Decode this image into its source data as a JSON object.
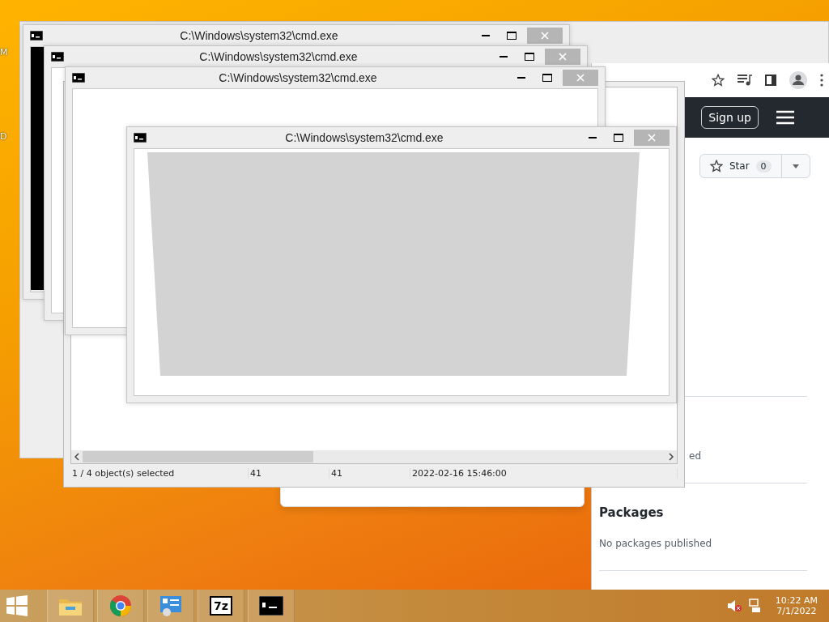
{
  "desktop": {
    "icon_labels": [
      "M",
      "D"
    ]
  },
  "browser": {
    "sign_up": "Sign up",
    "star": {
      "label": "Star",
      "count": "0"
    },
    "fragment": "ed",
    "packages": {
      "title": "Packages",
      "text": "No packages published"
    }
  },
  "file_manager": {
    "status_bar": [
      "1 / 4 object(s) selected",
      "41",
      "41",
      "2022-02-16 15:46:00"
    ]
  },
  "cmd_windows": [
    {
      "title": "C:\\Windows\\system32\\cmd.exe",
      "kind": "black"
    },
    {
      "title": "C:\\Windows\\system32\\cmd.exe",
      "kind": "white"
    },
    {
      "title": "C:\\Windows\\system32\\cmd.exe",
      "kind": "white"
    },
    {
      "title": "C:\\Windows\\system32\\cmd.exe",
      "kind": "grey"
    }
  ],
  "taskbar": {
    "apps": [
      {
        "kind": "folder"
      },
      {
        "kind": "chrome"
      },
      {
        "kind": "control-panel"
      },
      {
        "kind": "archive",
        "label": "7z"
      },
      {
        "kind": "console"
      }
    ],
    "clock": {
      "time": "10:22 AM",
      "date": "7/1/2022"
    }
  }
}
